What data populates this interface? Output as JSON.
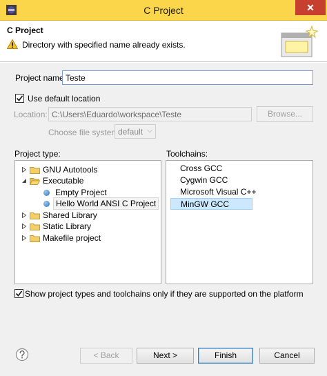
{
  "window": {
    "title": "C Project",
    "close_glyph": "✕"
  },
  "header": {
    "title": "C Project",
    "message": "Directory with specified name already exists."
  },
  "project_name": {
    "label": "Project name:",
    "value": "Teste"
  },
  "default_location": {
    "label": "Use default location",
    "checked": true
  },
  "location": {
    "label": "Location:",
    "value": "C:\\Users\\Eduardo\\workspace\\Teste",
    "browse_label": "Browse..."
  },
  "file_system": {
    "label": "Choose file system:",
    "value": "default"
  },
  "project_type": {
    "label": "Project type:",
    "items": [
      {
        "label": "GNU Autotools",
        "kind": "folder",
        "expanded": false
      },
      {
        "label": "Executable",
        "kind": "folder",
        "expanded": true
      },
      {
        "label": "Empty Project",
        "kind": "leaf"
      },
      {
        "label": "Hello World ANSI C Project",
        "kind": "leaf",
        "selected": true
      },
      {
        "label": "Shared Library",
        "kind": "folder",
        "expanded": false
      },
      {
        "label": "Static Library",
        "kind": "folder",
        "expanded": false
      },
      {
        "label": "Makefile project",
        "kind": "folder",
        "expanded": false
      }
    ]
  },
  "toolchains": {
    "label": "Toolchains:",
    "items": [
      "Cross GCC",
      "Cygwin GCC",
      "Microsoft Visual C++",
      "MinGW GCC"
    ],
    "selected_index": 3
  },
  "supported_only": {
    "label": "Show project types and toolchains only if they are supported on the platform",
    "checked": true
  },
  "buttons": {
    "back": "< Back",
    "next": "Next >",
    "finish": "Finish",
    "cancel": "Cancel"
  },
  "colors": {
    "titlebar": "#fbd64a",
    "close": "#c7402f",
    "selection": "#cce8ff"
  }
}
